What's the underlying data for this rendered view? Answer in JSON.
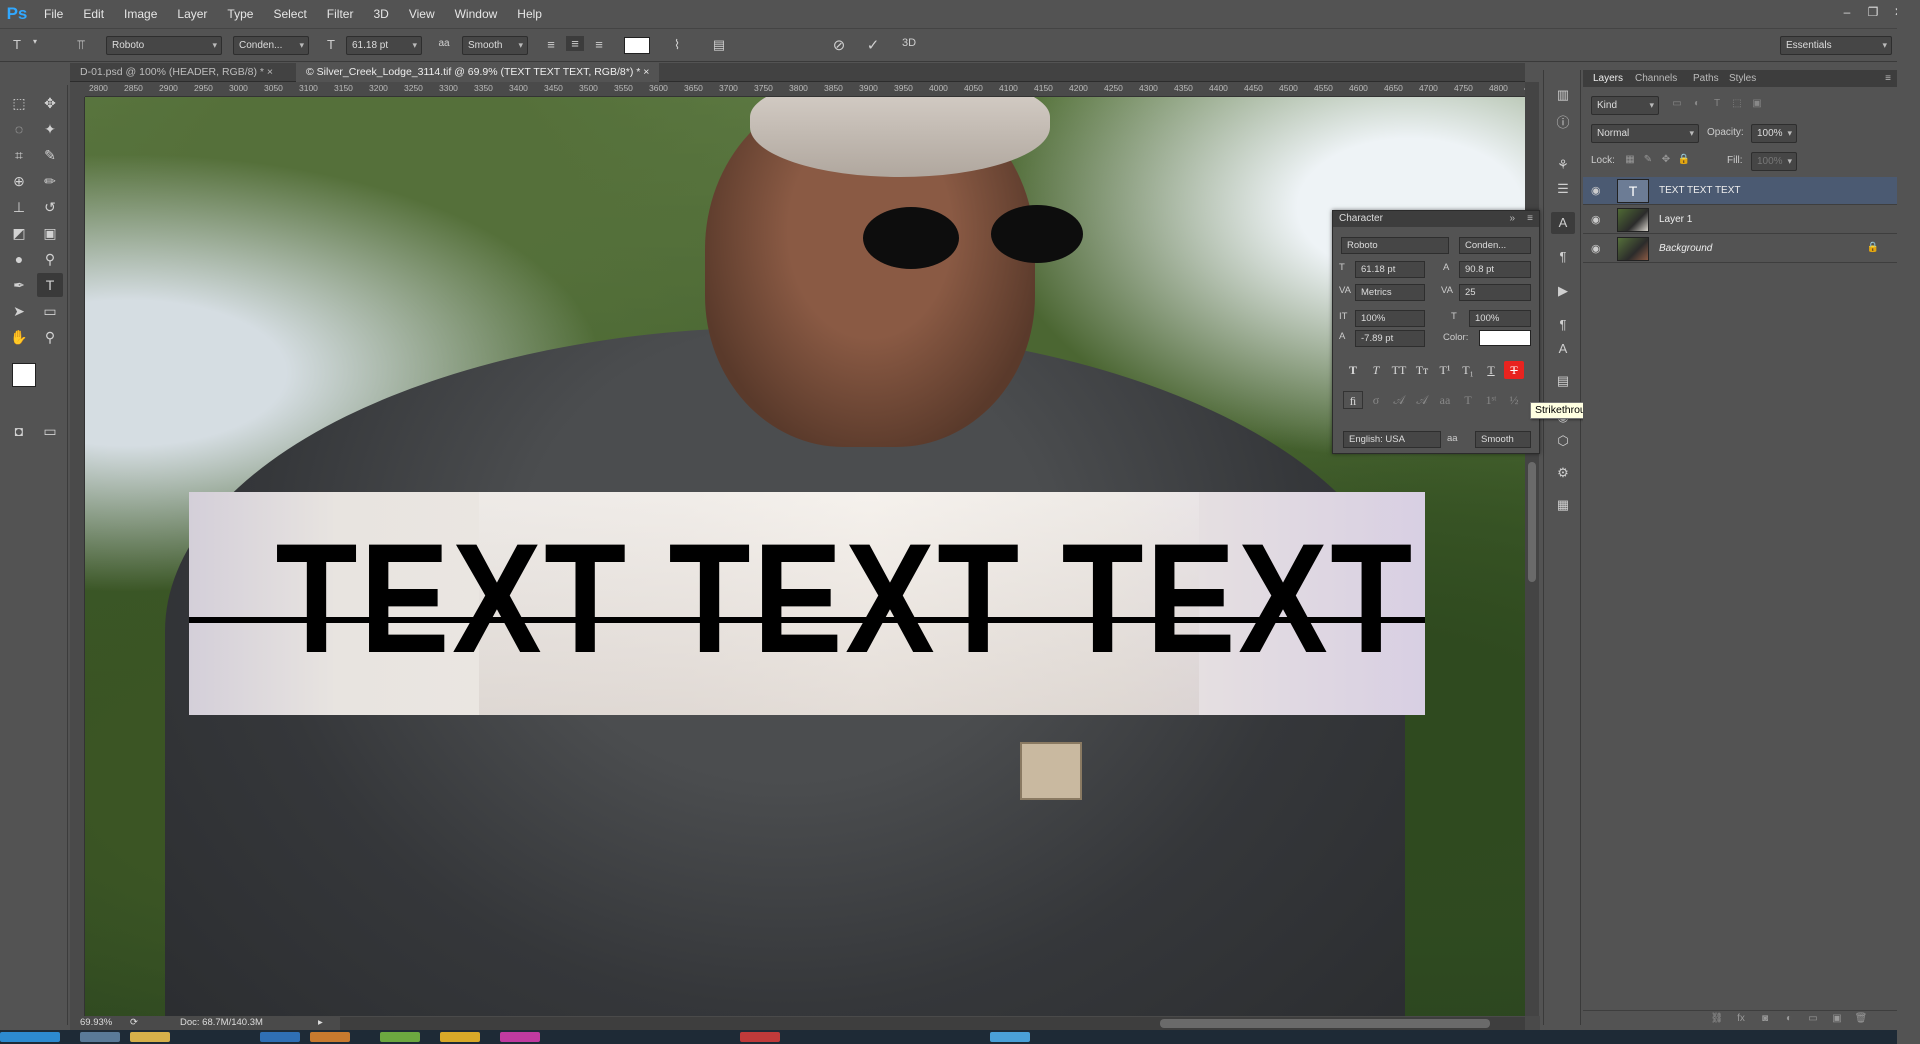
{
  "app": {
    "logo": "Ps"
  },
  "menu": [
    "File",
    "Edit",
    "Image",
    "Layer",
    "Type",
    "Select",
    "Filter",
    "3D",
    "View",
    "Window",
    "Help"
  ],
  "window_controls": {
    "minimize": "–",
    "restore": "❐",
    "close": "✕"
  },
  "options": {
    "font_family": "Roboto",
    "font_style": "Conden...",
    "font_size": "61.18 pt",
    "antialias_icon": "aa",
    "antialias": "Smooth",
    "text_color": "#ffffff",
    "workspace": "Essentials"
  },
  "doc_tabs": [
    {
      "label": "D-01.psd @ 100% (HEADER, RGB/8) *",
      "close": "×"
    },
    {
      "label": "© Silver_Creek_Lodge_3114.tif @ 69.9% (TEXT TEXT TEXT, RGB/8*) *",
      "close": "×"
    }
  ],
  "ruler_ticks": [
    "2800",
    "2850",
    "2900",
    "2950",
    "3000",
    "3050",
    "3100",
    "3150",
    "3200",
    "3250",
    "3300",
    "3350",
    "3400",
    "3450",
    "3500",
    "3550",
    "3600",
    "3650",
    "3700",
    "3750",
    "3800",
    "3850",
    "3900",
    "3950",
    "4000",
    "4050",
    "4100",
    "4150",
    "4200",
    "4250",
    "4300",
    "4350",
    "4400",
    "4450",
    "4500",
    "4550",
    "4600",
    "4650",
    "4700",
    "4750",
    "4800",
    "48"
  ],
  "canvas": {
    "text_layer": "TEXT TEXT TEXT"
  },
  "status": {
    "zoom": "69.93%",
    "doc": "Doc: 68.7M/140.3M"
  },
  "character": {
    "title": "Character",
    "font_family": "Roboto",
    "font_style": "Conden...",
    "size": "61.18 pt",
    "leading": "90.8 pt",
    "kerning": "Metrics",
    "tracking": "25",
    "vscale": "100%",
    "hscale": "100%",
    "baseline": "-7.89 pt",
    "color_label": "Color:",
    "color": "#ffffff",
    "language": "English: USA",
    "aa_icon": "aa",
    "antialias": "Smooth"
  },
  "tooltip": "Strikethrough",
  "layers_panel": {
    "tabs": [
      "Layers",
      "Channels",
      "Paths",
      "Styles"
    ],
    "filter_kind": "Kind",
    "blend_mode": "Normal",
    "opacity_label": "Opacity:",
    "opacity": "100%",
    "lock_label": "Lock:",
    "fill_label": "Fill:",
    "fill": "100%",
    "layers": [
      {
        "name": "TEXT TEXT TEXT",
        "thumb": "T",
        "selected": true
      },
      {
        "name": "Layer 1",
        "selected": false
      },
      {
        "name": "Background",
        "selected": false,
        "locked": true
      }
    ]
  }
}
